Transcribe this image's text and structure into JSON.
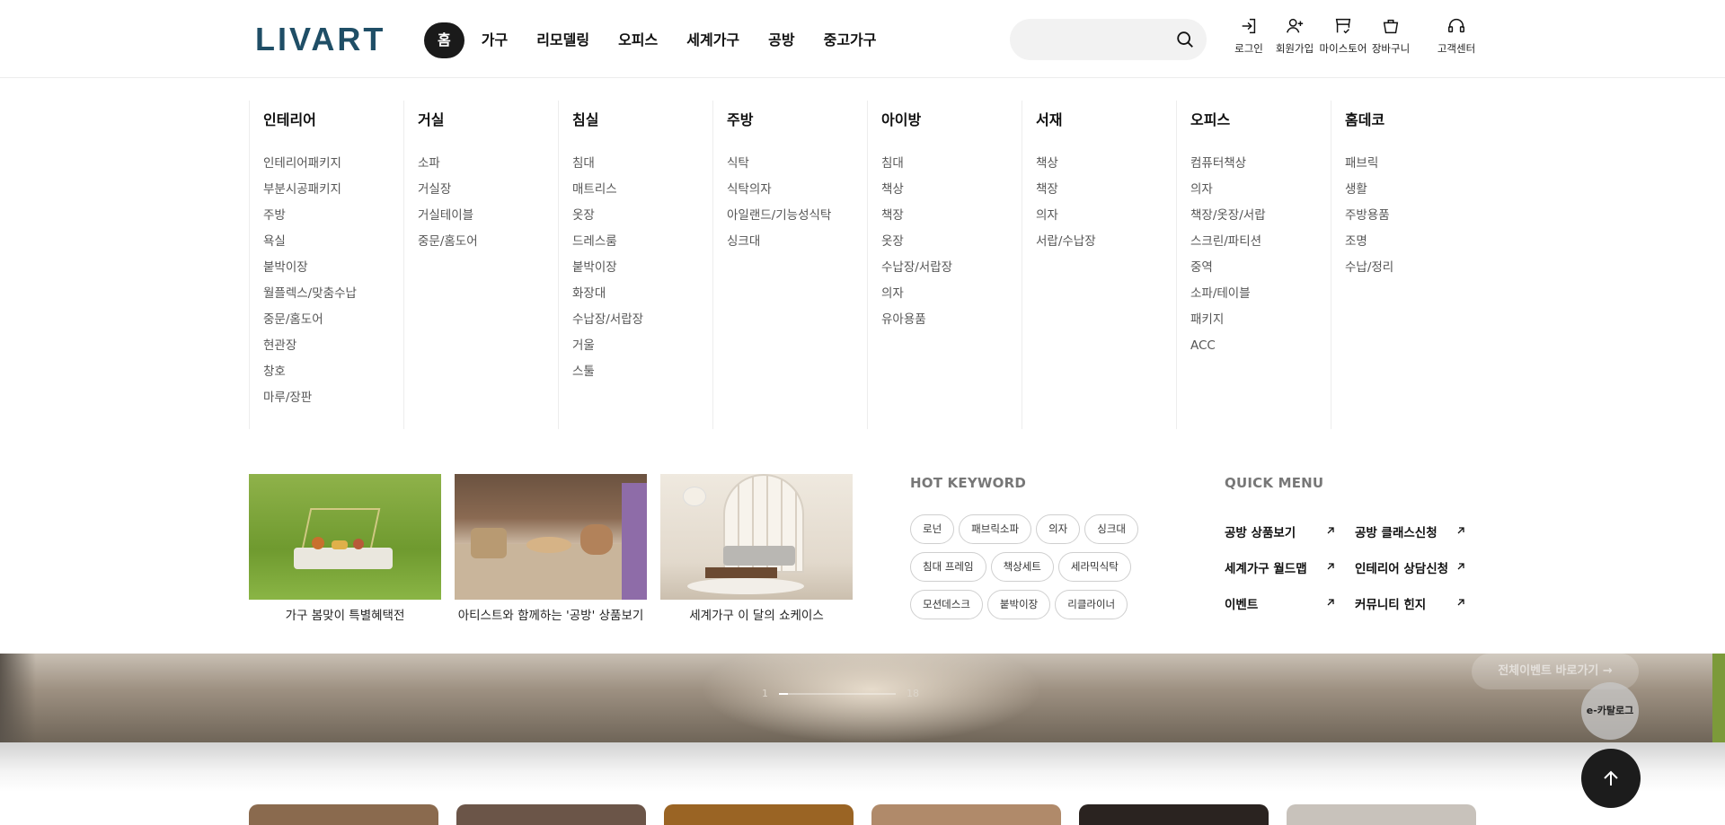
{
  "brand": {
    "name": "LIVART",
    "color": "#1f4e66"
  },
  "nav": [
    {
      "label": "홈",
      "active": true
    },
    {
      "label": "가구"
    },
    {
      "label": "리모델링"
    },
    {
      "label": "오피스"
    },
    {
      "label": "세계가구"
    },
    {
      "label": "공방"
    },
    {
      "label": "중고가구"
    }
  ],
  "search": {
    "placeholder": "",
    "icon": "search-icon"
  },
  "utils": [
    {
      "label": "로그인",
      "icon": "login-icon"
    },
    {
      "label": "회원가입",
      "icon": "signup-icon"
    },
    {
      "label": "마이스토어",
      "icon": "store-icon"
    },
    {
      "label": "장바구니",
      "icon": "cart-icon"
    },
    {
      "label": "고객센터",
      "icon": "headset-icon"
    }
  ],
  "menu": [
    {
      "title": "인테리어",
      "items": [
        "인테리어패키지",
        "부분시공패키지",
        "주방",
        "욕실",
        "붙박이장",
        "월플렉스/맞춤수납",
        "중문/홈도어",
        "현관장",
        "창호",
        "마루/장판"
      ]
    },
    {
      "title": "거실",
      "items": [
        "소파",
        "거실장",
        "거실테이블",
        "중문/홈도어"
      ]
    },
    {
      "title": "침실",
      "items": [
        "침대",
        "매트리스",
        "옷장",
        "드레스룸",
        "붙박이장",
        "화장대",
        "수납장/서랍장",
        "거울",
        "스툴"
      ]
    },
    {
      "title": "주방",
      "items": [
        "식탁",
        "식탁의자",
        "아일랜드/기능성식탁",
        "싱크대"
      ]
    },
    {
      "title": "아이방",
      "items": [
        "침대",
        "책상",
        "책장",
        "옷장",
        "수납장/서랍장",
        "의자",
        "유아용품"
      ]
    },
    {
      "title": "서재",
      "items": [
        "책상",
        "책장",
        "의자",
        "서랍/수납장"
      ]
    },
    {
      "title": "오피스",
      "items": [
        "컴퓨터책상",
        "의자",
        "책장/옷장/서랍",
        "스크린/파티션",
        "중역",
        "소파/테이블",
        "패키지",
        "ACC"
      ]
    },
    {
      "title": "홈데코",
      "items": [
        "패브릭",
        "생활",
        "주방용품",
        "조명",
        "수납/정리"
      ]
    }
  ],
  "promos": [
    {
      "caption": "가구 봄맞이 특별혜택전"
    },
    {
      "caption": "아티스트와 함께하는 '공방' 상품보기"
    },
    {
      "caption": "세계가구 이 달의 쇼케이스"
    }
  ],
  "hot_keyword": {
    "title": "HOT KEYWORD",
    "rows": [
      [
        "로넌",
        "패브릭소파",
        "의자",
        "싱크대"
      ],
      [
        "침대 프레임",
        "책상세트",
        "세라믹식탁"
      ],
      [
        "모션데스크",
        "붙박이장",
        "리클라이너"
      ]
    ]
  },
  "quick_menu": {
    "title": "QUICK MENU",
    "items": [
      [
        "공방 상품보기",
        "공방 클래스신청"
      ],
      [
        "세계가구 월드맵",
        "인테리어 상담신청"
      ],
      [
        "이벤트",
        "커뮤니티 힌지"
      ]
    ]
  },
  "hero": {
    "pager_start": "1",
    "pager_end": "18",
    "button_label": "전체이벤트 바로가기 →"
  },
  "floating": {
    "ecatalog_label": "e-카탈로그",
    "top_icon": "arrow-up-icon"
  }
}
